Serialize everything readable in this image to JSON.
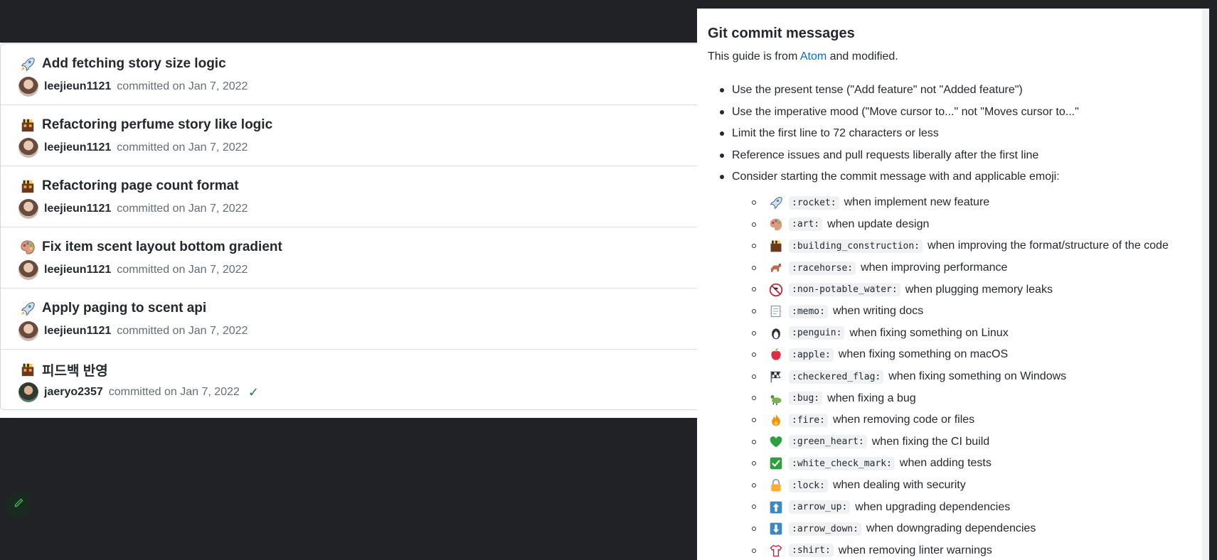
{
  "commits": [
    {
      "emoji": "rocket-icon",
      "title": "Add fetching story size logic",
      "author": "leejieun1121",
      "meta": "committed on Jan 7, 2022",
      "verified": false
    },
    {
      "emoji": "building-construction-icon",
      "title": "Refactoring perfume story like logic",
      "author": "leejieun1121",
      "meta": "committed on Jan 7, 2022",
      "verified": false
    },
    {
      "emoji": "building-construction-icon",
      "title": "Refactoring page count format",
      "author": "leejieun1121",
      "meta": "committed on Jan 7, 2022",
      "verified": false
    },
    {
      "emoji": "art-icon",
      "title": "Fix item scent layout bottom gradient",
      "author": "leejieun1121",
      "meta": "committed on Jan 7, 2022",
      "verified": false
    },
    {
      "emoji": "rocket-icon",
      "title": "Apply paging to scent api",
      "author": "leejieun1121",
      "meta": "committed on Jan 7, 2022",
      "verified": false
    },
    {
      "emoji": "building-construction-icon",
      "title": "피드백 반영",
      "author": "jaeryo2357",
      "meta": "committed on Jan 7, 2022",
      "verified": true
    }
  ],
  "guide": {
    "title": "Git commit messages",
    "intro_prefix": "This guide is from ",
    "intro_link": "Atom",
    "intro_suffix": " and modified.",
    "rules": [
      "Use the present tense (\"Add feature\" not \"Added feature\")",
      "Use the imperative mood (\"Move cursor to...\" not \"Moves cursor to...\"",
      "Limit the first line to 72 characters or less",
      "Reference issues and pull requests liberally after the first line",
      "Consider starting the commit message with and applicable emoji:"
    ],
    "emojis": [
      {
        "icon": "rocket-icon",
        "code": ":rocket:",
        "desc": "when implement new feature"
      },
      {
        "icon": "art-icon",
        "code": ":art:",
        "desc": "when update design"
      },
      {
        "icon": "building-construction-icon",
        "code": ":building_construction:",
        "desc": "when improving the format/structure of the code"
      },
      {
        "icon": "racehorse-icon",
        "code": ":racehorse:",
        "desc": "when improving performance"
      },
      {
        "icon": "non-potable-water-icon",
        "code": ":non-potable_water:",
        "desc": "when plugging memory leaks"
      },
      {
        "icon": "memo-icon",
        "code": ":memo:",
        "desc": "when writing docs"
      },
      {
        "icon": "penguin-icon",
        "code": ":penguin:",
        "desc": "when fixing something on Linux"
      },
      {
        "icon": "apple-icon",
        "code": ":apple:",
        "desc": "when fixing something on macOS"
      },
      {
        "icon": "checkered-flag-icon",
        "code": ":checkered_flag:",
        "desc": "when fixing something on Windows"
      },
      {
        "icon": "bug-icon",
        "code": ":bug:",
        "desc": "when fixing a bug"
      },
      {
        "icon": "fire-icon",
        "code": ":fire:",
        "desc": "when removing code or files"
      },
      {
        "icon": "green-heart-icon",
        "code": ":green_heart:",
        "desc": "when fixing the CI build"
      },
      {
        "icon": "white-check-mark-icon",
        "code": ":white_check_mark:",
        "desc": "when adding tests"
      },
      {
        "icon": "lock-icon",
        "code": ":lock:",
        "desc": "when dealing with security"
      },
      {
        "icon": "arrow-up-icon",
        "code": ":arrow_up:",
        "desc": "when upgrading dependencies"
      },
      {
        "icon": "arrow-down-icon",
        "code": ":arrow_down:",
        "desc": "when downgrading dependencies"
      },
      {
        "icon": "shirt-icon",
        "code": ":shirt:",
        "desc": "when removing linter warnings"
      }
    ]
  }
}
